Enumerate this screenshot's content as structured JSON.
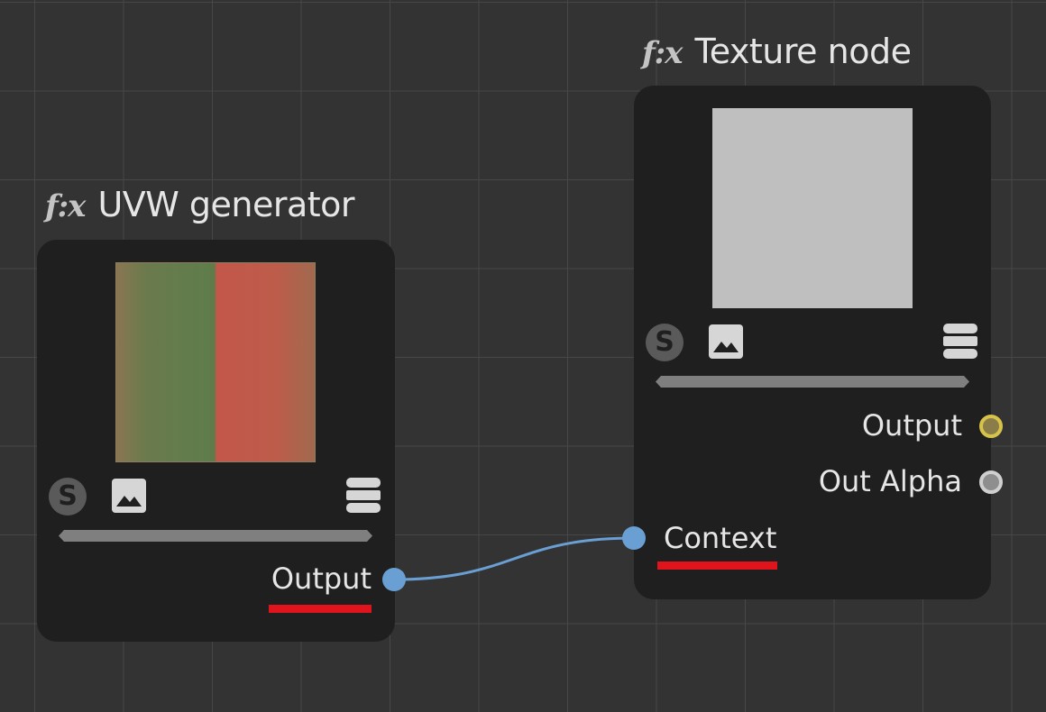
{
  "nodes": {
    "uvw_generator": {
      "fx_label": "f:x",
      "title": "UVW generator",
      "s_icon_label": "S",
      "ports": {
        "output": "Output"
      }
    },
    "texture_node": {
      "fx_label": "f:x",
      "title": "Texture node",
      "s_icon_label": "S",
      "ports": {
        "output": "Output",
        "out_alpha": "Out Alpha",
        "context": "Context"
      }
    }
  },
  "connections": [
    {
      "from": "UVW generator.Output",
      "to": "Texture node.Context"
    }
  ],
  "highlight_color": "#e0141c",
  "wire_color": "#6a9fd4",
  "port_colors": {
    "output": "#d8c34a",
    "out_alpha": "#cfcfcf",
    "context": "#6a9fd4"
  }
}
